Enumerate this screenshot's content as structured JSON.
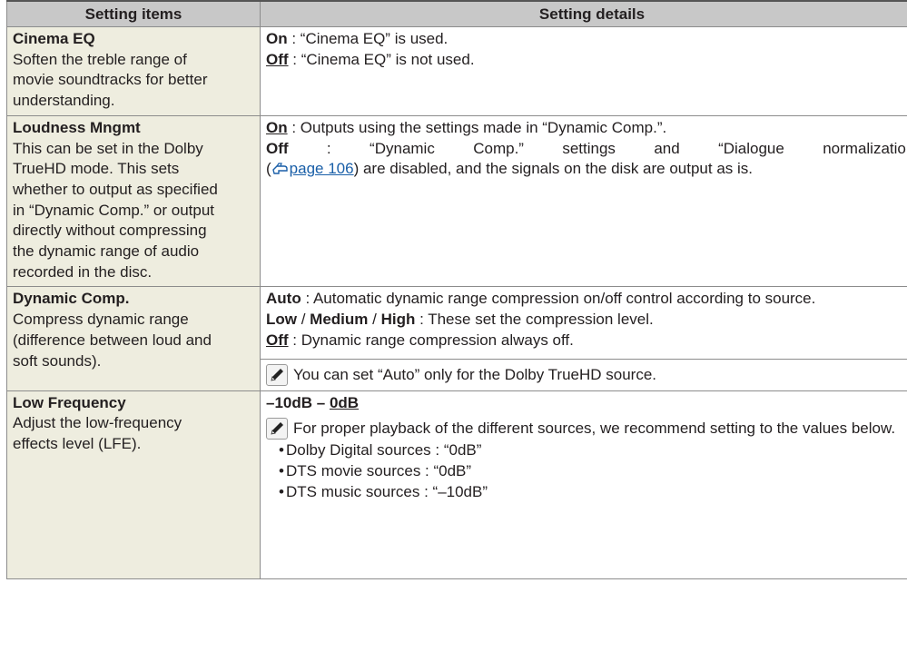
{
  "header": {
    "col1": "Setting items",
    "col2": "Setting details"
  },
  "rows": {
    "cinema_eq": {
      "name": "Cinema EQ",
      "desc": "Soften the treble range of movie soundtracks for better understanding.",
      "on_key": "On",
      "on_text": " : “Cinema EQ” is used.",
      "off_key": "Off",
      "off_text": " : “Cinema EQ” is not used."
    },
    "loudness": {
      "name": "Loudness Mngmt",
      "desc": "This can be set in the Dolby TrueHD mode. This sets whether to output as specified in “Dynamic Comp.” or output directly without compressing the dynamic range of audio recorded in the disc.",
      "on_key": "On",
      "on_text": " : Outputs using the settings made in “Dynamic Comp.”.",
      "off_key": "Off",
      "off_text": " : “Dynamic Comp.” settings and “Dialogue normalization”",
      "paren_open": "(",
      "link": "page 106",
      "off_text2": ") are disabled, and the signals on the disk are output as is."
    },
    "dynamic_comp": {
      "name": "Dynamic Comp.",
      "desc": "Compress dynamic range (difference between loud and soft sounds).",
      "auto_key": "Auto",
      "auto_text": " : Automatic dynamic range compression on/off control according to source.",
      "low_key": "Low",
      "slash": " / ",
      "medium_key": "Medium",
      "high_key": "High",
      "levels_text": " : These set the compression level.",
      "off_key": "Off",
      "off_text": " : Dynamic range compression always off.",
      "note": "You can set “Auto” only for the Dolby TrueHD source."
    },
    "low_freq": {
      "name": "Low Frequency",
      "desc": "Adjust the low-frequency effects level (LFE).",
      "range_prefix": "–10dB – ",
      "range_default": "0dB",
      "note": "For proper playback of the different sources, we recommend setting to the values below.",
      "bullets": [
        "Dolby Digital sources : “0dB”",
        "DTS movie sources : “0dB”",
        "DTS music sources : “–10dB”"
      ]
    }
  },
  "colors": {
    "item_bg": "#eeeddf",
    "header_bg": "#c8c8c8",
    "link": "#1a5fa8"
  }
}
